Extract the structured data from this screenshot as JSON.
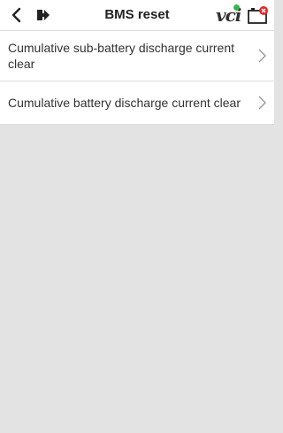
{
  "header": {
    "title": "BMS reset",
    "vci_label": "vci"
  },
  "menu": {
    "items": [
      {
        "label": "Cumulative sub-battery discharge current clear"
      },
      {
        "label": "Cumulative battery discharge current clear"
      }
    ]
  },
  "icons": {
    "back": "chevron-left-icon",
    "exit": "exit-icon",
    "vci": "vci-status-icon",
    "battery": "battery-alert-icon",
    "chevron": "chevron-right-icon"
  },
  "colors": {
    "background": "#e3e3e3",
    "vci_connected": "#39b54a",
    "battery_alert": "#e8262b"
  }
}
